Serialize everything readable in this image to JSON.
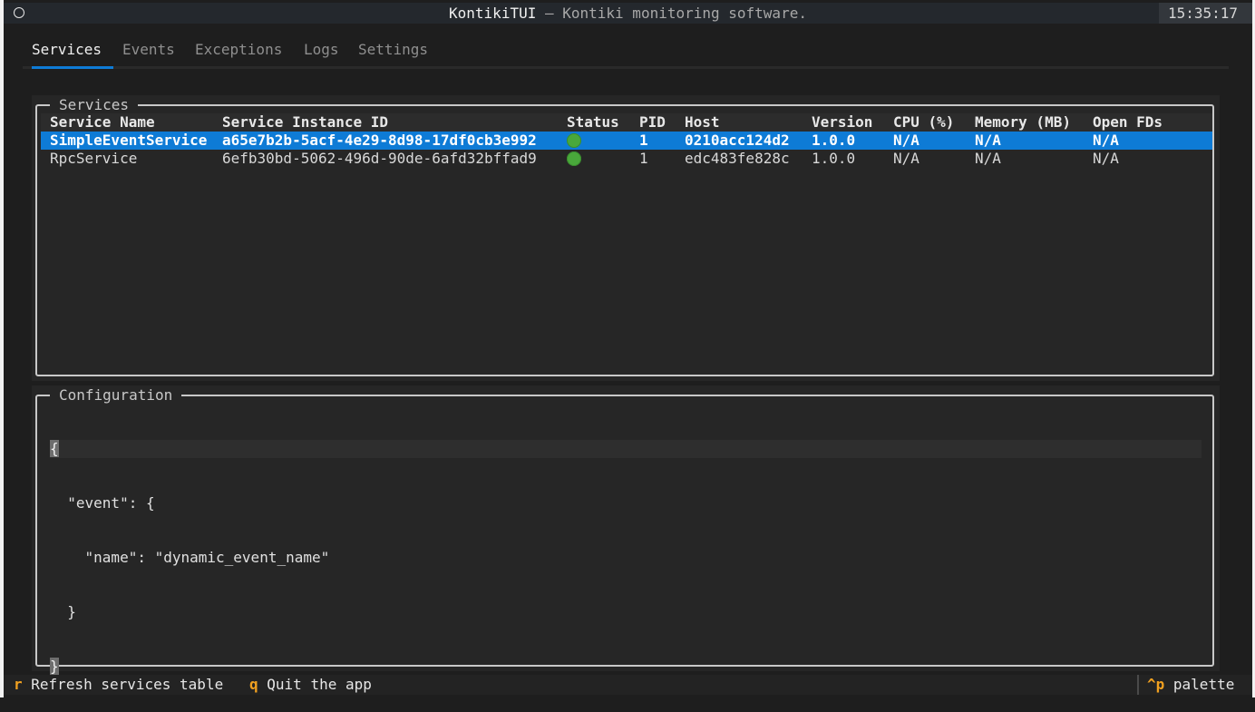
{
  "window": {
    "app_name": "KontikiTUI",
    "subtitle": " — Kontiki monitoring software.",
    "clock": "15:35:17"
  },
  "tabs": [
    {
      "label": "Services",
      "active": true
    },
    {
      "label": "Events",
      "active": false
    },
    {
      "label": "Exceptions",
      "active": false
    },
    {
      "label": "Logs",
      "active": false
    },
    {
      "label": "Settings",
      "active": false
    }
  ],
  "services_panel": {
    "title": "Services",
    "columns": [
      "Service Name",
      "Service Instance ID",
      "Status",
      "PID",
      "Host",
      "Version",
      "CPU (%)",
      "Memory (MB)",
      "Open FDs"
    ],
    "rows": [
      {
        "name": "SimpleEventService",
        "instance_id": "a65e7b2b-5acf-4e29-8d98-17df0cb3e992",
        "status": "running",
        "pid": "1",
        "host": "0210acc124d2",
        "version": "1.0.0",
        "cpu": "N/A",
        "memory": "N/A",
        "fds": "N/A",
        "selected": true
      },
      {
        "name": "RpcService",
        "instance_id": "6efb30bd-5062-496d-90de-6afd32bffad9",
        "status": "running",
        "pid": "1",
        "host": "edc483fe828c",
        "version": "1.0.0",
        "cpu": "N/A",
        "memory": "N/A",
        "fds": "N/A",
        "selected": false
      }
    ]
  },
  "config_panel": {
    "title": "Configuration",
    "lines": [
      "{",
      "  \"event\": {",
      "    \"name\": \"dynamic_event_name\"",
      "  }",
      "}"
    ]
  },
  "footer": {
    "refresh_key": "r",
    "refresh_label": "Refresh services table",
    "quit_key": "q",
    "quit_label": "Quit the app",
    "palette_key": "^p",
    "palette_label": "palette"
  },
  "colors": {
    "accent": "#0e7bd6",
    "status_running": "#49a83b",
    "key_highlight": "#f0a020"
  }
}
